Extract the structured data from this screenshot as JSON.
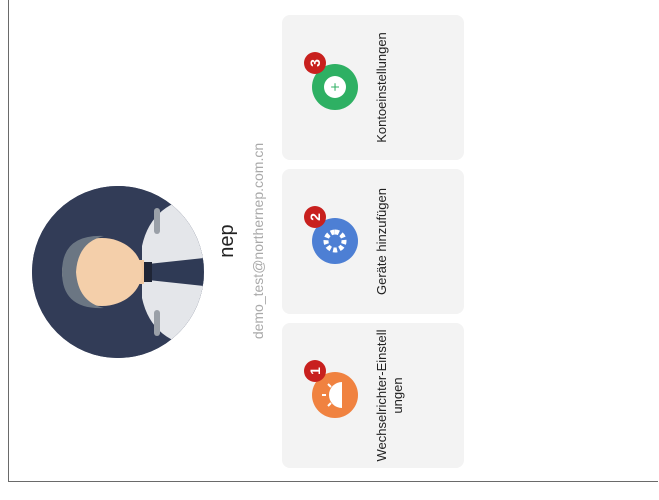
{
  "profile": {
    "name": "nep",
    "email": "demo_test@northernep.com.cn"
  },
  "cards": [
    {
      "label": "Wechselrichter-Einstellungen",
      "badge": "1",
      "color": "#f08240",
      "icon": "sun-icon"
    },
    {
      "label": "Geräte hinzufügen",
      "badge": "2",
      "color": "#4d7fd4",
      "icon": "gear-icon"
    },
    {
      "label": "Kontoeinstellungen",
      "badge": "3",
      "color": "#2eb063",
      "icon": "account-icon"
    }
  ]
}
